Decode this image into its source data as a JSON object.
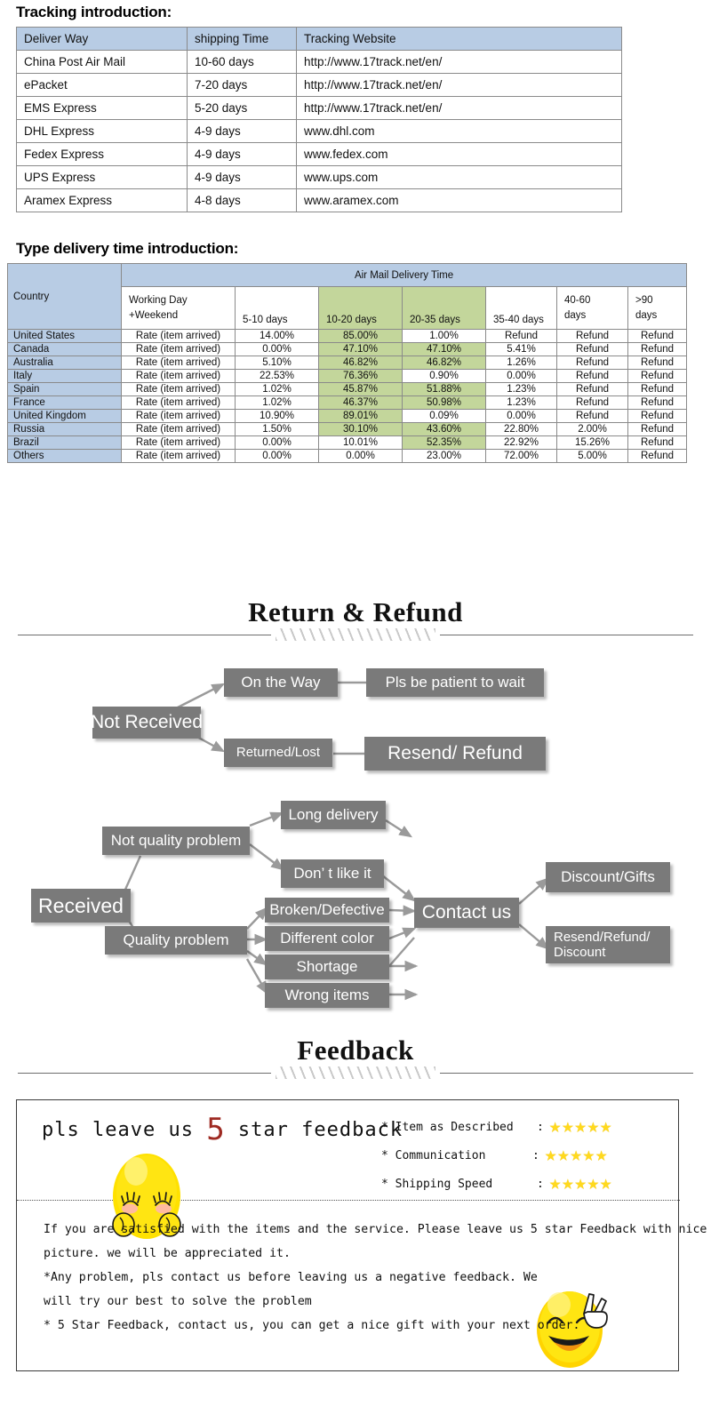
{
  "tracking": {
    "title": "Tracking introduction:",
    "columns": [
      "Deliver Way",
      "shipping Time",
      "Tracking Website"
    ],
    "rows": [
      [
        "China Post Air Mail",
        "10-60 days",
        "http://www.17track.net/en/"
      ],
      [
        "ePacket",
        "7-20 days",
        "http://www.17track.net/en/"
      ],
      [
        "EMS Express",
        "5-20 days",
        "http://www.17track.net/en/"
      ],
      [
        "DHL Express",
        "4-9 days",
        "www.dhl.com"
      ],
      [
        "Fedex Express",
        "4-9 days",
        "www.fedex.com"
      ],
      [
        "UPS Express",
        "4-9 days",
        "www.ups.com"
      ],
      [
        "Aramex Express",
        "4-8 days",
        "www.aramex.com"
      ]
    ]
  },
  "delivery": {
    "title": "Type delivery time introduction:",
    "country_header": "Country",
    "group_header": "Air Mail Delivery Time",
    "working_day_line1": "Working Day",
    "working_day_line2": "+Weekend",
    "range_headers": [
      "5-10 days",
      "10-20 days",
      "20-35 days",
      "35-40 days",
      "40-60 days",
      ">90 days"
    ],
    "range_headers_wrapped": [
      "40-60",
      "days",
      ">90",
      "days"
    ],
    "rate_label": "Rate (item arrived)",
    "rows": [
      {
        "country": "United States",
        "values": [
          "14.00%",
          "85.00%",
          "1.00%",
          "Refund",
          "Refund",
          "Refund"
        ]
      },
      {
        "country": "Canada",
        "values": [
          "0.00%",
          "47.10%",
          "47.10%",
          "5.41%",
          "Refund",
          "Refund"
        ]
      },
      {
        "country": "Australia",
        "values": [
          "5.10%",
          "46.82%",
          "46.82%",
          "1.26%",
          "Refund",
          "Refund"
        ]
      },
      {
        "country": "Italy",
        "values": [
          "22.53%",
          "76.36%",
          "0.90%",
          "0.00%",
          "Refund",
          "Refund"
        ]
      },
      {
        "country": "Spain",
        "values": [
          "1.02%",
          "45.87%",
          "51.88%",
          "1.23%",
          "Refund",
          "Refund"
        ]
      },
      {
        "country": "France",
        "values": [
          "1.02%",
          "46.37%",
          "50.98%",
          "1.23%",
          "Refund",
          "Refund"
        ]
      },
      {
        "country": "United Kingdom",
        "values": [
          "10.90%",
          "89.01%",
          "0.09%",
          "0.00%",
          "Refund",
          "Refund"
        ]
      },
      {
        "country": "Russia",
        "values": [
          "1.50%",
          "30.10%",
          "43.60%",
          "22.80%",
          "2.00%",
          "Refund"
        ]
      },
      {
        "country": "Brazil",
        "values": [
          "0.00%",
          "10.01%",
          "52.35%",
          "22.92%",
          "15.26%",
          "Refund"
        ]
      },
      {
        "country": "Others",
        "values": [
          "0.00%",
          "0.00%",
          "23.00%",
          "72.00%",
          "5.00%",
          "Refund"
        ]
      }
    ],
    "highlight_color": "#c3d69b",
    "header_color": "#b8cce4"
  },
  "return_section": {
    "heading": "Return & Refund",
    "nodes": {
      "not_received": "Not Received",
      "on_the_way": "On the Way",
      "pls_be_patient": "Pls be patient to wait",
      "returned_lost": "Returned/Lost",
      "resend_refund": "Resend/ Refund",
      "received": "Received",
      "not_quality_problem": "Not quality problem",
      "long_delivery": "Long delivery",
      "dont_like_it": "Don’ t like it",
      "quality_problem": "Quality problem",
      "broken_defective": "Broken/Defective",
      "different_color": "Different color",
      "shortage": "Shortage",
      "wrong_items": "Wrong items",
      "contact_us": "Contact us",
      "discount_gifts": "Discount/Gifts",
      "resend_refund_discount": "Resend/Refund/ Discount"
    },
    "node_color": "#7a7a7a"
  },
  "feedback": {
    "heading": "Feedback",
    "pls_prefix": "pls leave us ",
    "pls_number": "5",
    "pls_suffix": " star feedback",
    "ratings": [
      {
        "label": "* Item as Described",
        "colon": ":",
        "stars": "★★★★★"
      },
      {
        "label": "* Communication",
        "colon": ":",
        "stars": "★★★★★"
      },
      {
        "label": "* Shipping Speed",
        "colon": ":",
        "stars": "★★★★★"
      }
    ],
    "body_lines": [
      "If you are satisfied with the items and the service. Please leave us 5 star Feedback with nice",
      "picture. we will be appreciated it.",
      "*Any problem, pls contact us before leaving us a negative feedback. We",
      "will try our best to solve  the problem",
      "* 5 Star Feedback, contact us, you can get a nice gift with your next order."
    ],
    "star_color": "#ffd91e",
    "number_color": "#9e2a22"
  }
}
